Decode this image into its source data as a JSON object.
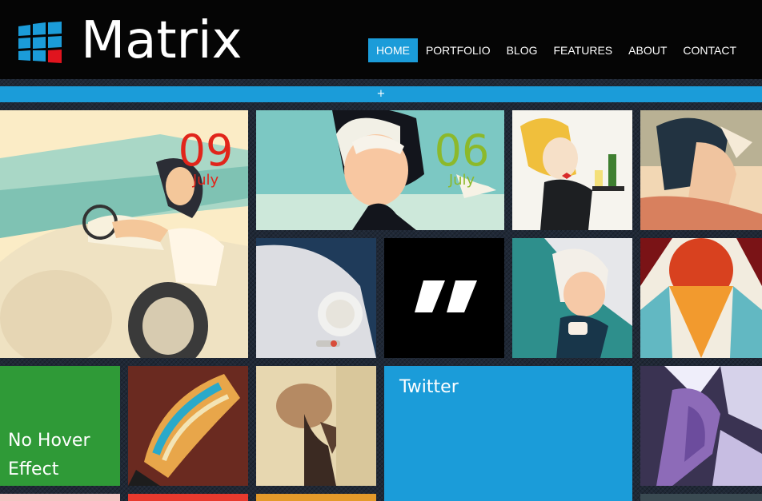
{
  "header": {
    "logo_text": "Matrix",
    "nav": [
      {
        "label": "HOME",
        "active": true
      },
      {
        "label": "PORTFOLIO",
        "active": false
      },
      {
        "label": "BLOG",
        "active": false
      },
      {
        "label": "FEATURES",
        "active": false
      },
      {
        "label": "ABOUT",
        "active": false
      },
      {
        "label": "CONTACT",
        "active": false
      }
    ]
  },
  "toggle": {
    "label": "+"
  },
  "tiles": {
    "post_1": {
      "day": "09",
      "month": "July",
      "color": "#e1251b"
    },
    "post_2": {
      "day": "06",
      "month": "July",
      "color": "#8cb92b"
    },
    "no_hover": {
      "label_line1": "No Hover",
      "label_line2": "Effect"
    },
    "twitter": {
      "label": "Twitter"
    }
  },
  "colors": {
    "accent_blue": "#1b9cd9",
    "green": "#2f9a37",
    "header_bg": "#050505"
  }
}
